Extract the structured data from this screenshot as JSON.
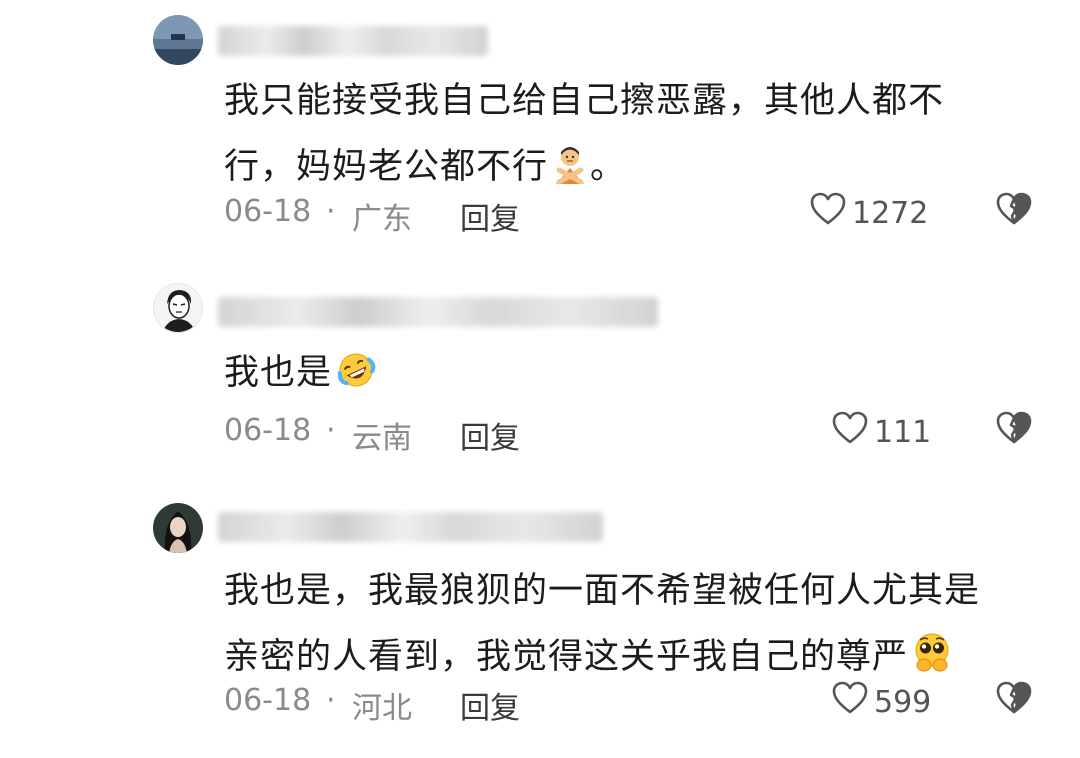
{
  "comments": [
    {
      "text_lines": [
        "我只能接受我自己给自己擦恶露，其他人都不",
        "行，妈妈老公都不行"
      ],
      "trailing_emoji": "person-gesturing-no-emoji",
      "text_suffix": "。",
      "date": "06-18",
      "separator": "·",
      "region": "广东",
      "reply_label": "回复",
      "like_count": "1272",
      "avatar": "ocean-landscape-avatar"
    },
    {
      "text_lines": [
        "我也是"
      ],
      "trailing_emoji": "rolling-on-floor-laughing-emoji",
      "text_suffix": "",
      "date": "06-18",
      "separator": "·",
      "region": "云南",
      "reply_label": "回复",
      "like_count": "111",
      "avatar": "cartoon-man-avatar"
    },
    {
      "text_lines": [
        "我也是，我最狼狈的一面不希望被任何人尤其是",
        "亲密的人看到，我觉得这关乎我自己的尊严"
      ],
      "trailing_emoji": "pleading-face-emoji",
      "text_suffix": "",
      "date": "06-18",
      "separator": "·",
      "region": "河北",
      "reply_label": "回复",
      "like_count": "599",
      "avatar": "woman-portrait-avatar"
    }
  ],
  "colors": {
    "meta_text": "#8a8a8a",
    "reply_text": "#3a3a3a",
    "icon_stroke": "#555555"
  }
}
